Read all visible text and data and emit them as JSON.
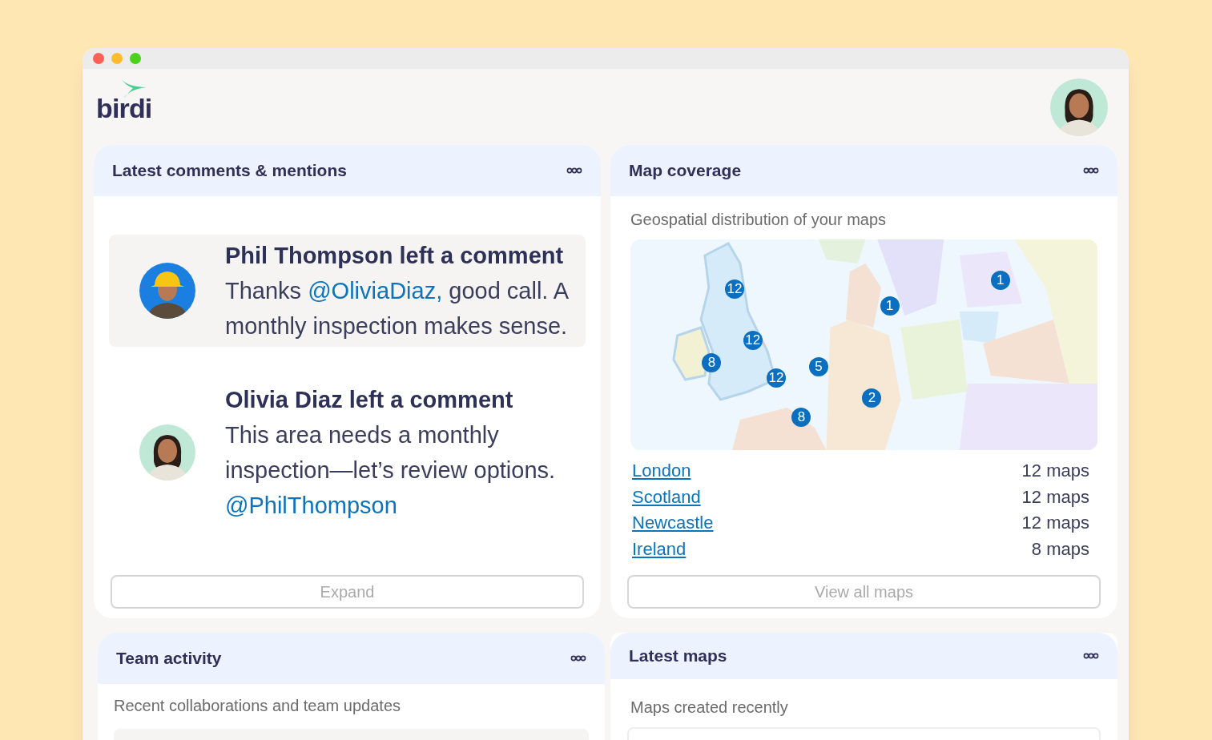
{
  "window_controls": [
    {
      "color": "#fe5f57"
    },
    {
      "color": "#febc2e"
    },
    {
      "color": "#4cd11d"
    }
  ],
  "logo": {
    "text": "birdi"
  },
  "comments_card": {
    "title": "Latest comments & mentions",
    "comments": [
      {
        "selected": true,
        "kind": "hardhat",
        "heading": "Phil Thompson left a comment",
        "body": "Thanks ",
        "mention": "@OliviaDiaz,",
        "rest": " good call. A monthly inspection makes sense."
      },
      {
        "selected": false,
        "kind": "plain",
        "heading": "Olivia Diaz left a comment",
        "body": "This area needs a monthly inspection—let’s review options. ",
        "mention": "@PhilThompson"
      }
    ],
    "button": "Expand"
  },
  "map_card": {
    "title": "Map coverage",
    "subtitle": "Geospatial distribution of your maps",
    "pins": [
      "12",
      "12",
      "8",
      "12",
      "5",
      "2",
      "8",
      "1",
      "1"
    ],
    "locations": [
      {
        "name": "London",
        "count": "12 maps"
      },
      {
        "name": "Scotland",
        "count": "12 maps"
      },
      {
        "name": "Newcastle",
        "count": "12 maps"
      },
      {
        "name": "Ireland",
        "count": "8 maps"
      }
    ],
    "button": "View all maps"
  },
  "team_card": {
    "title": "Team activity",
    "subtitle": "Recent collaborations and team updates"
  },
  "maps_card": {
    "title": "Latest maps",
    "subtitle": "Maps created recently"
  }
}
